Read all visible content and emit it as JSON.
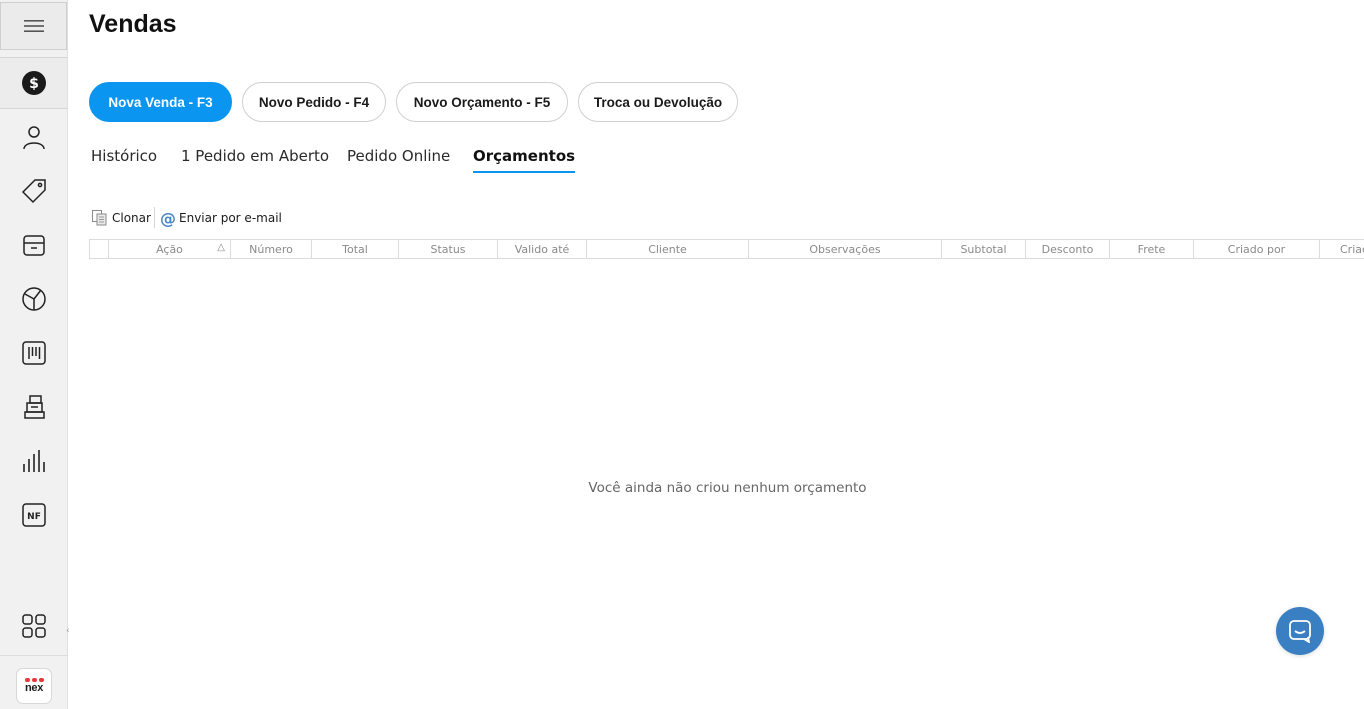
{
  "sidebar": {
    "menu_icon": "hamburger-icon",
    "items": [
      {
        "id": "vendas",
        "icon": "dollar-coin-icon",
        "active": true
      },
      {
        "id": "clientes",
        "icon": "person-icon"
      },
      {
        "id": "produtos",
        "icon": "tag-icon"
      },
      {
        "id": "estoque",
        "icon": "box-icon"
      },
      {
        "id": "financeiro",
        "icon": "pie-chart-icon"
      },
      {
        "id": "codigo-barras",
        "icon": "barcode-icon"
      },
      {
        "id": "caixa",
        "icon": "register-icon"
      },
      {
        "id": "relatorios",
        "icon": "bar-chart-icon"
      },
      {
        "id": "nota-fiscal",
        "icon": "nf-icon",
        "label": "NF"
      }
    ],
    "apps_icon": "apps-grid-icon",
    "logo_text": "nex",
    "collapse_glyph": "‹"
  },
  "page": {
    "title": "Vendas"
  },
  "actions": [
    {
      "label": "Nova Venda - F3",
      "primary": true
    },
    {
      "label": "Novo Pedido - F4"
    },
    {
      "label": "Novo Orçamento - F5"
    },
    {
      "label": "Troca ou Devolução"
    }
  ],
  "tabs": [
    {
      "label": "Histórico"
    },
    {
      "label": "1 Pedido em Aberto"
    },
    {
      "label": "Pedido Online"
    },
    {
      "label": "Orçamentos",
      "active": true
    }
  ],
  "toolbar": {
    "clone_label": "Clonar",
    "email_label": "Enviar por e-mail",
    "email_glyph": "@"
  },
  "grid": {
    "columns": [
      "Ação",
      "Número",
      "Total",
      "Status",
      "Valido até",
      "Cliente",
      "Observações",
      "Subtotal",
      "Desconto",
      "Frete",
      "Criado por",
      "Criado"
    ],
    "sort_glyph": "△"
  },
  "empty_message": "Você ainda não criou nenhum orçamento",
  "colors": {
    "accent": "#0a95f0",
    "chat": "#3a7fc2",
    "logo_red": "#e53940"
  }
}
